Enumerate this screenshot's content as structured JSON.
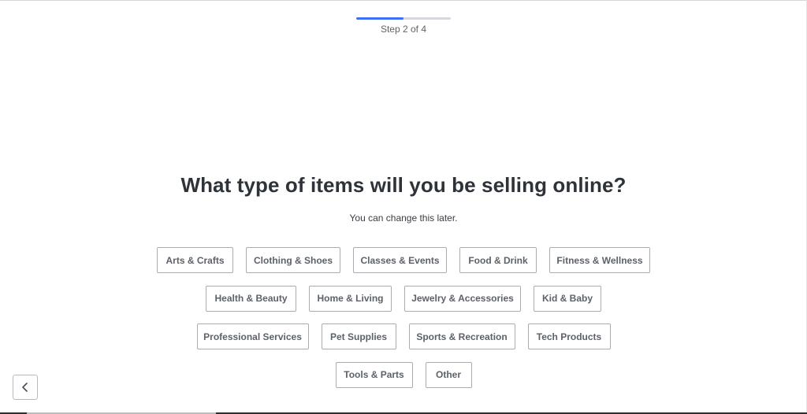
{
  "progress": {
    "step_label": "Step 2 of 4",
    "current_step": 2,
    "total_steps": 4,
    "fraction": 0.5,
    "fill_color": "#3e6ff4",
    "track_color": "#d5d8dc"
  },
  "question": {
    "title": "What type of items will you be selling online?",
    "subtitle": "You can change this later."
  },
  "options": {
    "rows": [
      [
        "Arts & Crafts",
        "Clothing & Shoes",
        "Classes & Events",
        "Food & Drink",
        "Fitness & Wellness"
      ],
      [
        "Health & Beauty",
        "Home & Living",
        "Jewelry & Accessories",
        "Kid & Baby"
      ],
      [
        "Professional Services",
        "Pet Supplies",
        "Sports & Recreation",
        "Tech Products"
      ],
      [
        "Tools & Parts",
        "Other"
      ]
    ]
  },
  "navigation": {
    "back_icon": "chevron-left-icon"
  }
}
